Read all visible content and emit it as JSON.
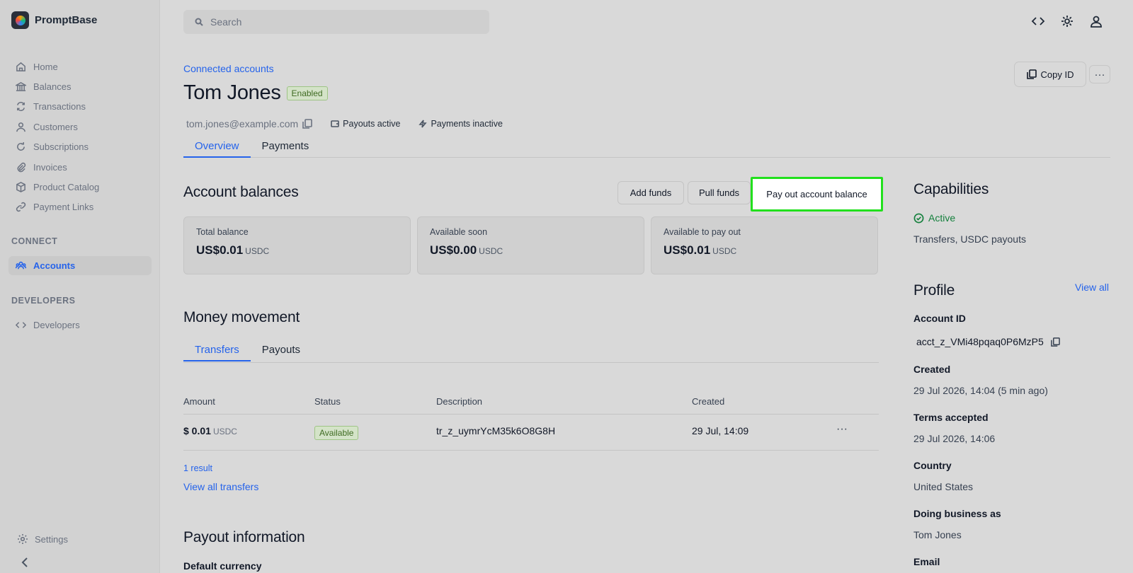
{
  "app": {
    "name": "PromptBase"
  },
  "sidebar": {
    "items": [
      {
        "label": "Home",
        "icon": "home-icon"
      },
      {
        "label": "Balances",
        "icon": "bank-icon"
      },
      {
        "label": "Transactions",
        "icon": "transactions-icon"
      },
      {
        "label": "Customers",
        "icon": "user-icon"
      },
      {
        "label": "Subscriptions",
        "icon": "refresh-icon"
      },
      {
        "label": "Invoices",
        "icon": "paperclip-icon"
      },
      {
        "label": "Product Catalog",
        "icon": "box-icon"
      },
      {
        "label": "Payment Links",
        "icon": "link-icon"
      }
    ],
    "connect_heading": "CONNECT",
    "accounts_label": "Accounts",
    "developers_heading": "DEVELOPERS",
    "developers_label": "Developers",
    "settings_label": "Settings"
  },
  "search": {
    "placeholder": "Search"
  },
  "header": {
    "breadcrumb": "Connected accounts",
    "title": "Tom Jones",
    "status_badge": "Enabled",
    "email": "tom.jones@example.com",
    "payouts_status": "Payouts active",
    "payments_status": "Payments inactive",
    "copy_id_label": "Copy ID",
    "more_label": "···",
    "tabs": [
      "Overview",
      "Payments"
    ]
  },
  "balances": {
    "title": "Account balances",
    "add_funds": "Add funds",
    "pull_funds": "Pull funds",
    "pay_out": "Pay out account balance",
    "cards": [
      {
        "label": "Total balance",
        "value": "US$0.01",
        "unit": "USDC"
      },
      {
        "label": "Available soon",
        "value": "US$0.00",
        "unit": "USDC"
      },
      {
        "label": "Available to pay out",
        "value": "US$0.01",
        "unit": "USDC"
      }
    ]
  },
  "money_movement": {
    "title": "Money movement",
    "tabs": [
      "Transfers",
      "Payouts"
    ],
    "columns": [
      "Amount",
      "Status",
      "Description",
      "Created"
    ],
    "rows": [
      {
        "amount": "$ 0.01",
        "unit": "USDC",
        "status": "Available",
        "description": "tr_z_uymrYcM35k6O8G8H",
        "created": "29 Jul, 14:09",
        "more": "···"
      }
    ],
    "result_count": "1 result",
    "view_all": "View all transfers"
  },
  "payout_info": {
    "title": "Payout information",
    "default_currency_label": "Default currency"
  },
  "capabilities": {
    "title": "Capabilities",
    "status": "Active",
    "list": "Transfers, USDC payouts"
  },
  "profile": {
    "title": "Profile",
    "view_all": "View all",
    "account_id_label": "Account ID",
    "account_id": "acct_z_VMi48pqaq0P6MzP5",
    "created_label": "Created",
    "created": "29 Jul 2026, 14:04 (5 min ago)",
    "terms_label": "Terms accepted",
    "terms": "29 Jul 2026, 14:06",
    "country_label": "Country",
    "country": "United States",
    "dba_label": "Doing business as",
    "dba": "Tom Jones",
    "email_label": "Email"
  },
  "colors": {
    "accent": "#2563eb",
    "success": "#15803d",
    "highlight": "#22e01d"
  }
}
